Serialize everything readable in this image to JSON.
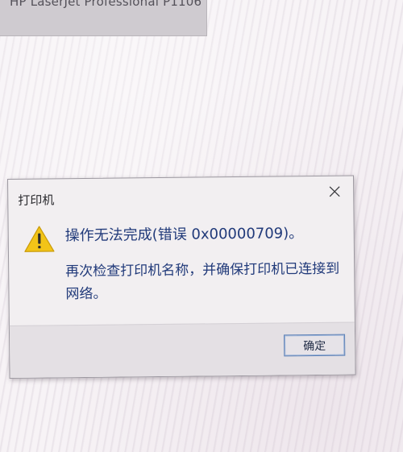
{
  "background_window": {
    "title": "HP LaserJet Professional P1106"
  },
  "dialog": {
    "title": "打印机",
    "close_icon": "close-icon",
    "warning_icon": "warning-icon",
    "message_main": "操作无法完成(错误 0x00000709)。",
    "message_detail": "再次检查打印机名称，并确保打印机已连接到网络。",
    "ok_label": "确定"
  },
  "colors": {
    "message_text": "#213a7a",
    "warning_yellow": "#f2c418",
    "button_border": "#5b7fb5"
  }
}
